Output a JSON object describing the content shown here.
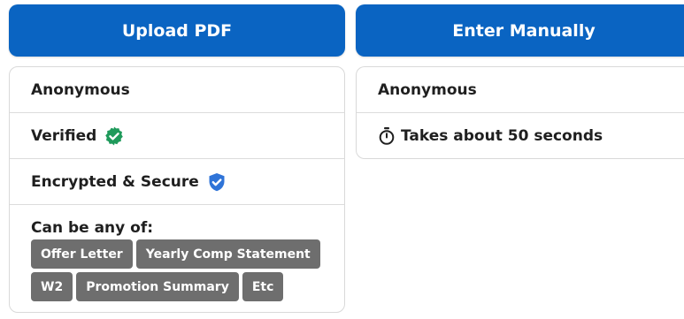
{
  "left": {
    "button_label": "Upload PDF",
    "features": [
      "Anonymous",
      "Verified",
      "Encrypted & Secure"
    ],
    "tags_label": "Can be any of:",
    "tags": [
      "Offer Letter",
      "Yearly Comp Statement",
      "W2",
      "Promotion Summary",
      "Etc"
    ]
  },
  "right": {
    "button_label": "Enter Manually",
    "features": [
      "Anonymous",
      "Takes about 50 seconds"
    ]
  },
  "colors": {
    "primary_button": "#0a64c2",
    "verified_green": "#1f9a5b",
    "secure_blue": "#2f74d8",
    "tag_gray": "#6e6e6e"
  },
  "icons": {
    "verified": "verified-check-badge-icon",
    "secure": "shield-check-icon",
    "timer": "stopwatch-icon"
  }
}
